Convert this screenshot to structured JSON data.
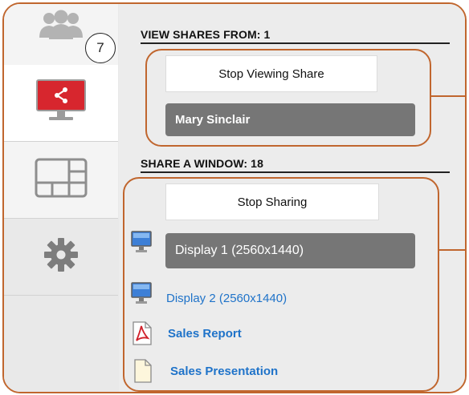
{
  "rail": {
    "tabs": [
      {
        "icon": "people-icon"
      },
      {
        "icon": "share-screen-icon"
      },
      {
        "icon": "layout-grid-icon"
      },
      {
        "icon": "gear-icon"
      }
    ],
    "badge": "7"
  },
  "view_shares": {
    "title": "VIEW SHARES FROM: 1",
    "stop_label": "Stop Viewing Share",
    "participant": "Mary Sinclair"
  },
  "share_window": {
    "title": "SHARE A WINDOW: 18",
    "stop_label": "Stop Sharing",
    "items": [
      {
        "label": "Display 1 (2560x1440)",
        "icon": "monitor-icon",
        "selected": true
      },
      {
        "label": "Display 2 (2560x1440)",
        "icon": "monitor-icon",
        "selected": false
      },
      {
        "label": "Sales Report",
        "icon": "pdf-icon",
        "selected": false
      },
      {
        "label": "Sales Presentation",
        "icon": "document-icon",
        "selected": false
      }
    ]
  },
  "colors": {
    "callout": "#c0662e",
    "active_share_red": "#d7262e",
    "link_blue": "#1f73c9",
    "selected_gray": "#767676"
  }
}
